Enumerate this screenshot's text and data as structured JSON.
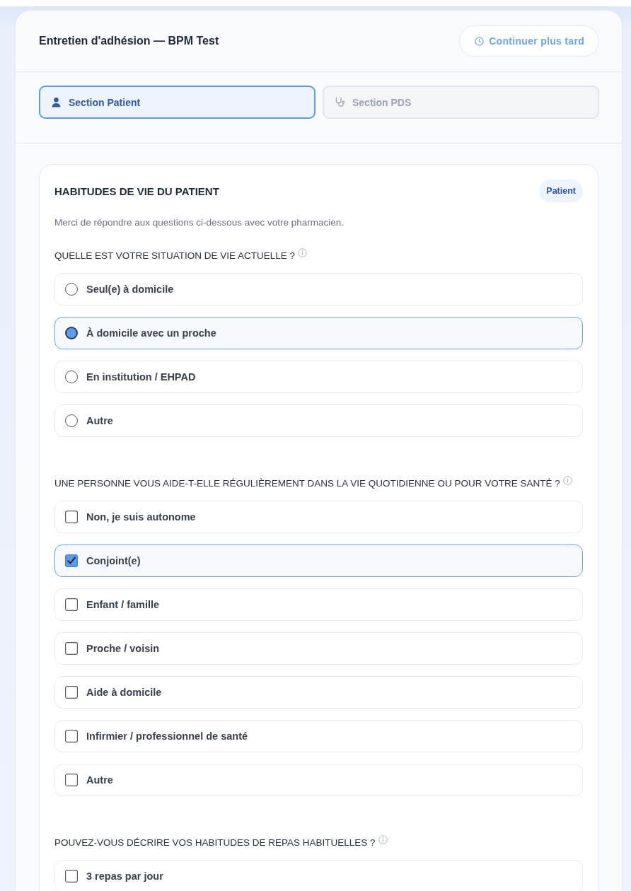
{
  "header": {
    "title": "Entretien d'adhésion — BPM Test",
    "action": {
      "label": "Continuer plus tard"
    }
  },
  "tabs": [
    {
      "label": "Section Patient",
      "kind": "patient",
      "selected": true
    },
    {
      "label": "Section PDS",
      "kind": "pds",
      "selected": false
    }
  ],
  "section": {
    "title": "HABITUDES DE VIE DU PATIENT",
    "badge": "Patient",
    "description": "Merci de répondre aux questions ci-dessous avec votre pharmacien.",
    "questions": [
      {
        "label": "QUELLE EST VOTRE SITUATION DE VIE ACTUELLE ?",
        "kind": "radio",
        "options": [
          {
            "label": "Seul(e) à domicile",
            "selected": false
          },
          {
            "label": "À domicile avec un proche",
            "selected": true
          },
          {
            "label": "En institution / EHPAD",
            "selected": false
          },
          {
            "label": "Autre",
            "selected": false
          }
        ]
      },
      {
        "label": "UNE PERSONNE VOUS AIDE-T-ELLE RÉGULIÈREMENT DANS LA VIE QUOTIDIENNE OU POUR VOTRE SANTÉ ?",
        "kind": "checkbox",
        "options": [
          {
            "label": "Non, je suis autonome",
            "selected": false
          },
          {
            "label": "Conjoint(e)",
            "selected": true
          },
          {
            "label": "Enfant / famille",
            "selected": false
          },
          {
            "label": "Proche / voisin",
            "selected": false
          },
          {
            "label": "Aide à domicile",
            "selected": false
          },
          {
            "label": "Infirmier / professionnel de santé",
            "selected": false
          },
          {
            "label": "Autre",
            "selected": false
          }
        ]
      },
      {
        "label": "POUVEZ-VOUS DÉCRIRE VOS HABITUDES DE REPAS HABITUELLES ?",
        "kind": "checkbox",
        "options": [
          {
            "label": "3 repas par jour",
            "selected": false
          }
        ]
      }
    ]
  }
}
